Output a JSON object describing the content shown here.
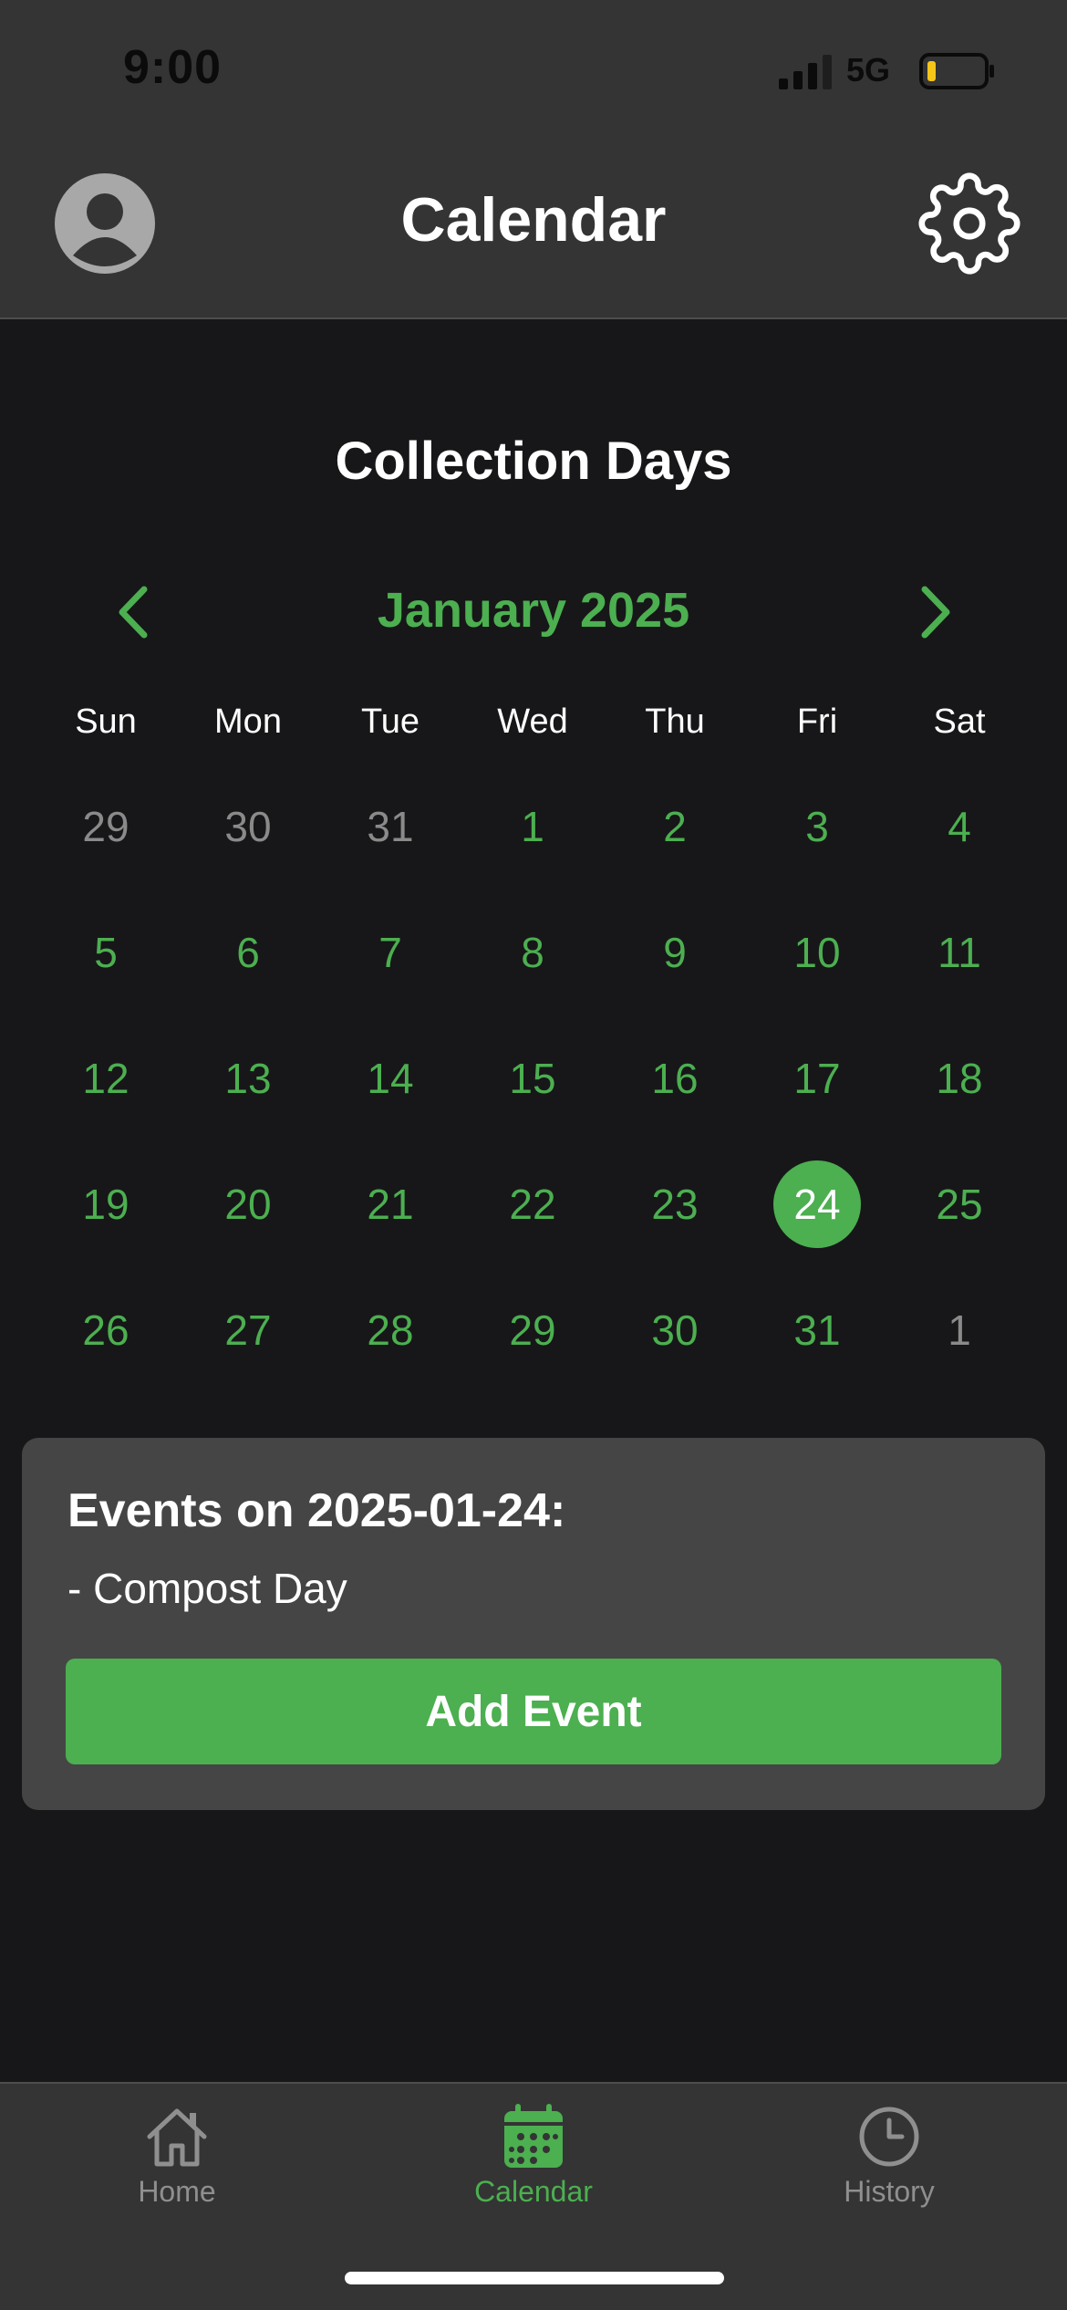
{
  "status_bar": {
    "time": "9:00",
    "network": "5G",
    "signal_icon": "cellular-signal-icon",
    "battery_icon": "battery-low-icon"
  },
  "header": {
    "title": "Calendar",
    "avatar_icon": "user-avatar-icon",
    "settings_icon": "gear-icon"
  },
  "calendar": {
    "section_title": "Collection Days",
    "month_label": "January 2025",
    "prev_icon": "chevron-left-icon",
    "next_icon": "chevron-right-icon",
    "weekdays": [
      "Sun",
      "Mon",
      "Tue",
      "Wed",
      "Thu",
      "Fri",
      "Sat"
    ],
    "days": [
      {
        "label": "29",
        "in_month": false
      },
      {
        "label": "30",
        "in_month": false
      },
      {
        "label": "31",
        "in_month": false
      },
      {
        "label": "1",
        "in_month": true
      },
      {
        "label": "2",
        "in_month": true
      },
      {
        "label": "3",
        "in_month": true
      },
      {
        "label": "4",
        "in_month": true
      },
      {
        "label": "5",
        "in_month": true
      },
      {
        "label": "6",
        "in_month": true
      },
      {
        "label": "7",
        "in_month": true
      },
      {
        "label": "8",
        "in_month": true
      },
      {
        "label": "9",
        "in_month": true
      },
      {
        "label": "10",
        "in_month": true
      },
      {
        "label": "11",
        "in_month": true
      },
      {
        "label": "12",
        "in_month": true
      },
      {
        "label": "13",
        "in_month": true
      },
      {
        "label": "14",
        "in_month": true
      },
      {
        "label": "15",
        "in_month": true
      },
      {
        "label": "16",
        "in_month": true
      },
      {
        "label": "17",
        "in_month": true
      },
      {
        "label": "18",
        "in_month": true
      },
      {
        "label": "19",
        "in_month": true
      },
      {
        "label": "20",
        "in_month": true
      },
      {
        "label": "21",
        "in_month": true
      },
      {
        "label": "22",
        "in_month": true
      },
      {
        "label": "23",
        "in_month": true
      },
      {
        "label": "24",
        "in_month": true,
        "selected": true
      },
      {
        "label": "25",
        "in_month": true
      },
      {
        "label": "26",
        "in_month": true
      },
      {
        "label": "27",
        "in_month": true
      },
      {
        "label": "28",
        "in_month": true
      },
      {
        "label": "29",
        "in_month": true
      },
      {
        "label": "30",
        "in_month": true
      },
      {
        "label": "31",
        "in_month": true
      },
      {
        "label": "1",
        "in_month": false
      }
    ]
  },
  "events": {
    "title": "Events on 2025-01-24:",
    "items": [
      "- Compost Day"
    ],
    "add_button_label": "Add Event"
  },
  "tab_bar": {
    "tabs": [
      {
        "label": "Home",
        "icon": "home-icon",
        "active": false
      },
      {
        "label": "Calendar",
        "icon": "calendar-icon",
        "active": true
      },
      {
        "label": "History",
        "icon": "clock-icon",
        "active": false
      }
    ]
  },
  "colors": {
    "accent": "#4caf50",
    "background": "#171719",
    "header_background": "#343434",
    "card_background": "#454545",
    "muted_text": "#8a8a8a"
  }
}
